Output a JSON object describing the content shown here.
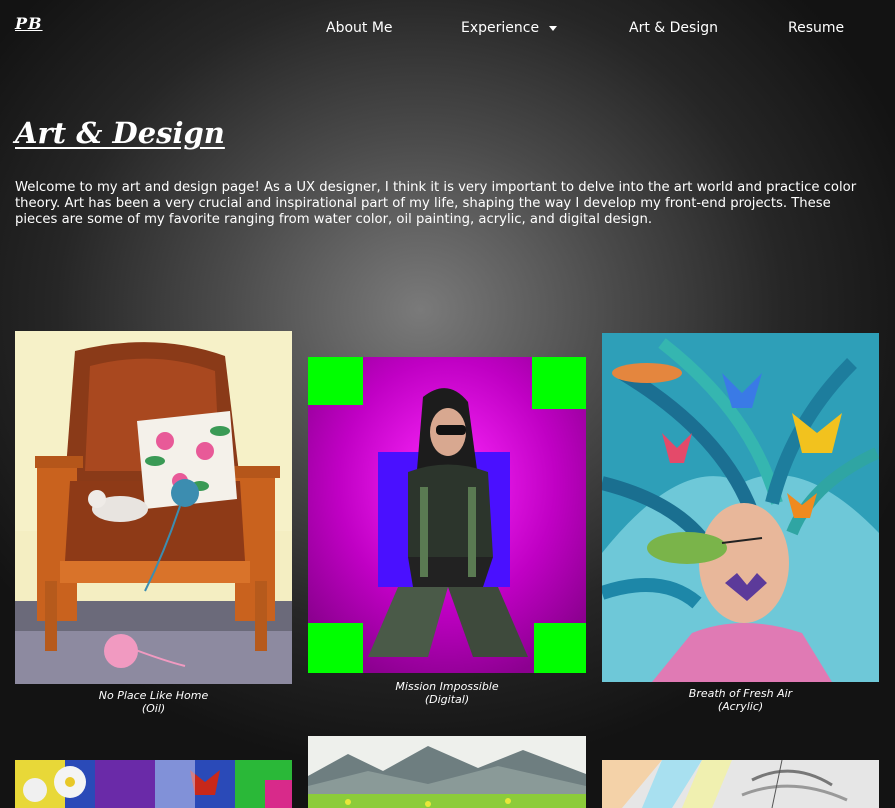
{
  "nav": {
    "logo": "PB",
    "items": [
      "About Me",
      "Experience",
      "Art & Design",
      "Resume"
    ]
  },
  "page": {
    "title": "Art & Design",
    "intro": "Welcome to my art and design page! As a UX designer, I think it is very important to delve into the art world and practice color theory. Art has been a very crucial and inspirational part of my life, shaping the way I develop my front-end projects. These pieces are some of my favorite ranging from water color, oil painting, acrylic, and digital design."
  },
  "gallery": [
    {
      "title": "No Place Like Home",
      "medium": "(Oil)",
      "icon": "painting-chair-cat-icon"
    },
    {
      "title": "Mission Impossible",
      "medium": "(Digital)",
      "icon": "painting-woman-digital-icon"
    },
    {
      "title": "Breath of Fresh Air",
      "medium": "(Acrylic)",
      "icon": "painting-woman-butterflies-icon"
    },
    {
      "title": "",
      "medium": "",
      "icon": "painting-flowers-butterfly-icon"
    },
    {
      "title": "",
      "medium": "",
      "icon": "painting-mountains-watercolor-icon"
    },
    {
      "title": "",
      "medium": "",
      "icon": "painting-sketch-icon"
    }
  ],
  "colors": {
    "accent": "#ffffff",
    "background": "#2b2b2b"
  }
}
